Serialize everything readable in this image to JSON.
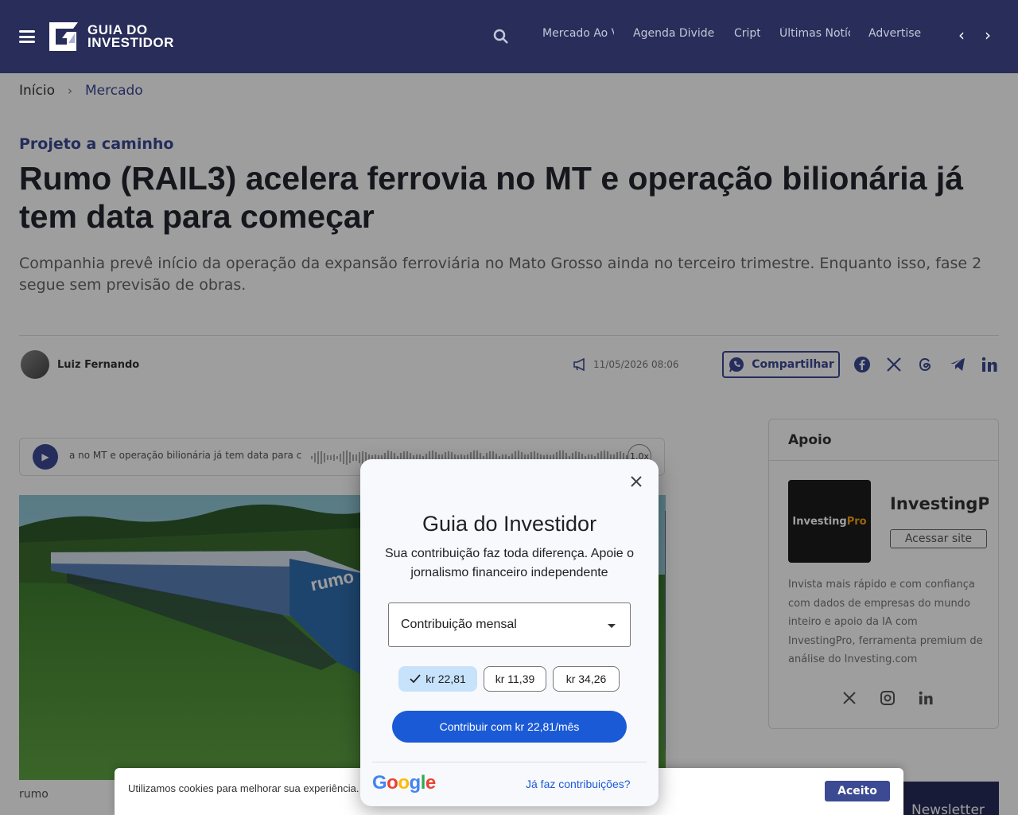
{
  "header": {
    "logo_line1": "GUIA DO",
    "logo_line2": "INVESTIDOR",
    "nav": [
      "Mercado Ao Vivo",
      "Agenda Dividendos",
      "Cripto",
      "Últimas Notícias",
      "Advertise"
    ]
  },
  "breadcrumb": {
    "home": "Início",
    "current": "Mercado"
  },
  "article": {
    "kicker": "Projeto a caminho",
    "title": "Rumo (RAIL3) acelera ferrovia no MT e operação bilionária já tem data para começar",
    "lede": "Companhia prevê início da operação da expansão ferroviária no Mato Grosso ainda no terceiro trimestre. Enquanto isso, fase 2 segue sem previsão de obras.",
    "author": "Luiz Fernando",
    "date": "11/05/2026 08:06",
    "share_label": "Compartilhar",
    "audio_text": "a no MT e operação bilionária já tem data para c",
    "audio_speed": "1.0x",
    "photo_caption": "rumo",
    "photo_brand": "rumo"
  },
  "sidebar": {
    "title": "Apoio",
    "logo_main": "Investing",
    "logo_pro": "Pro",
    "name": "InvestingPro",
    "button": "Acessar site",
    "description": "Invista mais rápido e com confiança com dados de empresas do mundo inteiro e apoio da IA com InvestingPro, ferramenta premium de análise do Investing.com"
  },
  "newsletter_label": "Newsletter",
  "cookie": {
    "text": "Utilizamos cookies para melhorar sua experiência.",
    "link": "e",
    "accept": "Aceito"
  },
  "modal": {
    "title": "Guia do Investidor",
    "subtitle": "Sua contribuição faz toda diferença. Apoie o jornalismo financeiro independente",
    "select_value": "Contribuição mensal",
    "amounts": [
      "kr 22,81",
      "kr 11,39",
      "kr 34,26"
    ],
    "selected_amount_index": 0,
    "cta": "Contribuir com kr 22,81/mês",
    "brand": "Google",
    "already": "Já faz contribuições?"
  },
  "colors": {
    "brand_navy": "#282d5a",
    "accent": "#3b4a93",
    "google_blue": "#1a5ad7"
  }
}
